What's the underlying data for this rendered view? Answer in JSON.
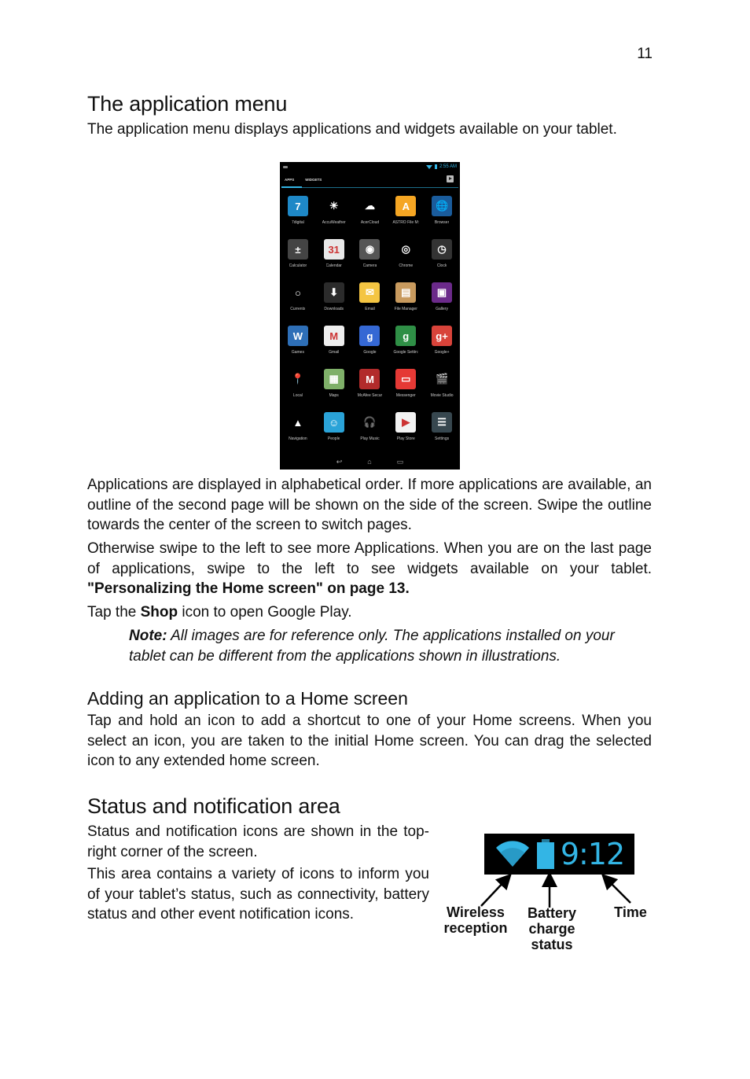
{
  "page_number": "11",
  "section1": {
    "title": "The application menu",
    "intro": "The application menu displays applications and widgets available on your tablet."
  },
  "tablet_screenshot": {
    "status_time": "2:55 AM",
    "tabs": [
      "APPS",
      "WIDGETS"
    ],
    "active_tab": "APPS",
    "apps": [
      {
        "label": "7digital",
        "icon": "7digital-icon",
        "glyph": "7",
        "color": "#1e88c7"
      },
      {
        "label": "AccuWeather",
        "icon": "sun-icon",
        "glyph": "☀",
        "color": "#000000"
      },
      {
        "label": "AcerCloud",
        "icon": "cloud-icon",
        "glyph": "☁",
        "color": "#000000"
      },
      {
        "label": "ASTRO File M:",
        "icon": "folder-icon",
        "glyph": "A",
        "color": "#f5a623"
      },
      {
        "label": "Browser",
        "icon": "globe-icon",
        "glyph": "🌐",
        "color": "#1a5c9c"
      },
      {
        "label": "Calculator",
        "icon": "calculator-icon",
        "glyph": "±",
        "color": "#444444"
      },
      {
        "label": "Calendar",
        "icon": "calendar-icon",
        "glyph": "31",
        "color": "#e8e8e8"
      },
      {
        "label": "Camera",
        "icon": "camera-icon",
        "glyph": "◉",
        "color": "#555555"
      },
      {
        "label": "Chrome",
        "icon": "chrome-icon",
        "glyph": "◎",
        "color": "#000000"
      },
      {
        "label": "Clock",
        "icon": "clock-icon",
        "glyph": "◷",
        "color": "#333333"
      },
      {
        "label": "Currents",
        "icon": "currents-icon",
        "glyph": "○",
        "color": "#000000"
      },
      {
        "label": "Downloads",
        "icon": "download-icon",
        "glyph": "⬇",
        "color": "#2b2b2b"
      },
      {
        "label": "Email",
        "icon": "email-icon",
        "glyph": "✉",
        "color": "#f4c542"
      },
      {
        "label": "File Manager",
        "icon": "file-manager-icon",
        "glyph": "▤",
        "color": "#c89a5e"
      },
      {
        "label": "Gallery",
        "icon": "gallery-icon",
        "glyph": "▣",
        "color": "#6b2a8a"
      },
      {
        "label": "Games",
        "icon": "games-icon",
        "glyph": "W",
        "color": "#2e6fb7"
      },
      {
        "label": "Gmail",
        "icon": "gmail-icon",
        "glyph": "M",
        "color": "#eeeeee"
      },
      {
        "label": "Google",
        "icon": "google-search-icon",
        "glyph": "g",
        "color": "#3568d4"
      },
      {
        "label": "Google Settin:",
        "icon": "google-settings-icon",
        "glyph": "g",
        "color": "#2f8f46"
      },
      {
        "label": "Google+",
        "icon": "google-plus-icon",
        "glyph": "g+",
        "color": "#d8433a"
      },
      {
        "label": "Local",
        "icon": "map-pin-icon",
        "glyph": "📍",
        "color": "#000000"
      },
      {
        "label": "Maps",
        "icon": "maps-icon",
        "glyph": "▦",
        "color": "#7fb069"
      },
      {
        "label": "McAfee Secur",
        "icon": "mcafee-shield-icon",
        "glyph": "M",
        "color": "#b22b2b"
      },
      {
        "label": "Messenger",
        "icon": "messenger-icon",
        "glyph": "▭",
        "color": "#e53935"
      },
      {
        "label": "Movie Studio",
        "icon": "clapperboard-icon",
        "glyph": "🎬",
        "color": "#000000"
      },
      {
        "label": "Navigation",
        "icon": "navigation-arrow-icon",
        "glyph": "▲",
        "color": "#000000"
      },
      {
        "label": "People",
        "icon": "people-icon",
        "glyph": "☺",
        "color": "#2aa3d8"
      },
      {
        "label": "Play Music",
        "icon": "headphones-icon",
        "glyph": "🎧",
        "color": "#000000"
      },
      {
        "label": "Play Store",
        "icon": "play-store-icon",
        "glyph": "▶",
        "color": "#f2f2f2"
      },
      {
        "label": "Settings",
        "icon": "settings-sliders-icon",
        "glyph": "☰",
        "color": "#37474f"
      }
    ],
    "nav_buttons": [
      "back",
      "home",
      "recent-apps"
    ]
  },
  "paragraphs": {
    "p1": "Applications are displayed in alphabetical order. If more applications are available, an outline of the second page will be shown on the side of the screen. Swipe the outline towards the center of the screen to switch pages.",
    "p2": "Otherwise swipe to the left to see more Applications. When you are on the last page of applications, swipe to the left to see widgets available on your tablet.",
    "p2_link": "\"Personalizing the Home screen\" on page 13.",
    "p3_pre": "Tap the ",
    "p3_bold": "Shop",
    "p3_post": " icon to open Google Play.",
    "note_label": "Note:",
    "note_text": " All images are for reference only. The applications installed on your tablet can be different from the applications shown in illustrations."
  },
  "section2": {
    "title": "Adding an application to a Home screen",
    "body": "Tap and hold an icon to add a shortcut to one of your Home screens. When you select an icon, you are taken to the initial Home screen. You can drag the selected icon to any extended home screen."
  },
  "section3": {
    "title": "Status and notification area",
    "p1": "Status and notification icons are shown in the top-right corner of the screen.",
    "p2": "This area contains a variety of icons to inform you of your tablet’s status, such as connectivity, battery status and other event notification icons."
  },
  "status_illustration": {
    "time": "9:12",
    "accent_color": "#33b5e5",
    "callouts": {
      "wireless": "Wireless reception",
      "battery": "Battery charge status",
      "time": "Time"
    }
  }
}
